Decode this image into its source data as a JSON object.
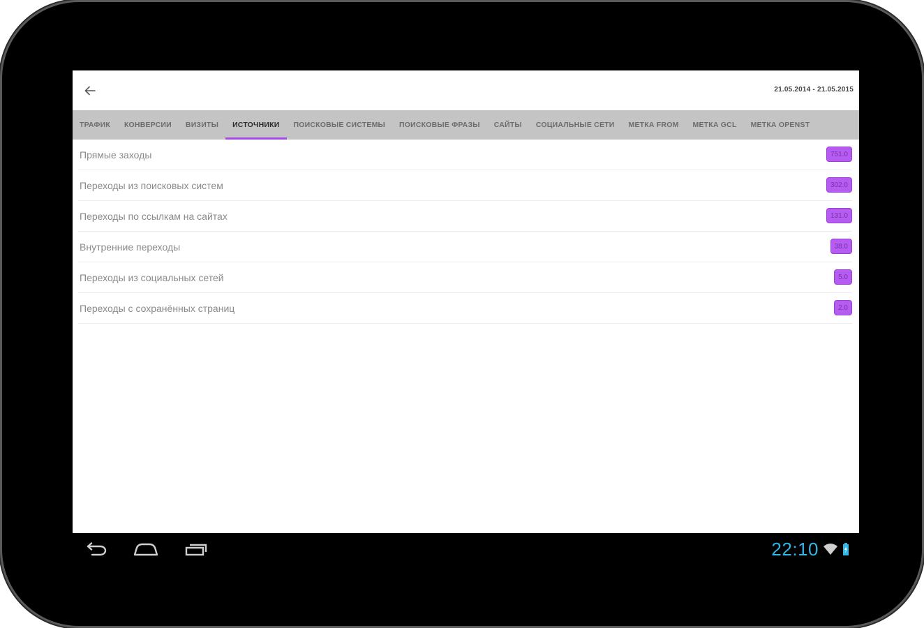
{
  "header": {
    "back_icon": "arrow-left-icon",
    "date_range": "21.05.2014 - 21.05.2015"
  },
  "tabs": [
    {
      "label": "ТРАФИК",
      "active": false
    },
    {
      "label": "КОНВЕРСИИ",
      "active": false
    },
    {
      "label": "ВИЗИТЫ",
      "active": false
    },
    {
      "label": "ИСТОЧНИКИ",
      "active": true
    },
    {
      "label": "ПОИСКОВЫЕ СИСТЕМЫ",
      "active": false
    },
    {
      "label": "ПОИСКОВЫЕ ФРАЗЫ",
      "active": false
    },
    {
      "label": "САЙТЫ",
      "active": false
    },
    {
      "label": "СОЦИАЛЬНЫЕ СЕТИ",
      "active": false
    },
    {
      "label": "МЕТКА FROM",
      "active": false
    },
    {
      "label": "МЕТКА GCL",
      "active": false
    },
    {
      "label": "МЕТКА OPENST",
      "active": false
    }
  ],
  "sources": [
    {
      "label": "Прямые заходы",
      "value": "751.0"
    },
    {
      "label": "Переходы из поисковых систем",
      "value": "302.0"
    },
    {
      "label": "Переходы по ссылкам на сайтах",
      "value": "131.0"
    },
    {
      "label": "Внутренние переходы",
      "value": "38.0"
    },
    {
      "label": "Переходы из социальных сетей",
      "value": "5.0"
    },
    {
      "label": "Переходы с сохранённых страниц",
      "value": "2.0"
    }
  ],
  "system": {
    "clock": "22:10",
    "icons": [
      "back-nav-icon",
      "home-icon",
      "recent-apps-icon",
      "wifi-icon",
      "battery-icon"
    ]
  },
  "colors": {
    "accent": "#a64ae6",
    "badge": "#b65cf0",
    "tab_bar": "#c4c4c4",
    "clock": "#33b5e5"
  }
}
